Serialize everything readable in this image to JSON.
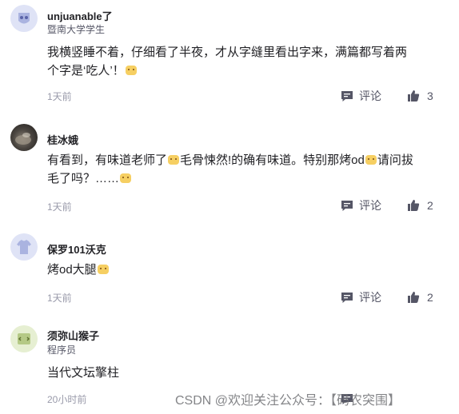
{
  "comments": [
    {
      "username": "unjuanable了",
      "subtitle": "暨南大学学生",
      "avatar": "student-avatar",
      "lines": [
        "我横竖睡不着，仔细看了半夜，才从字缝里看出字来，满篇都写着两",
        "个字是‘吃人’！"
      ],
      "time": "1天前",
      "reply_label": "评论",
      "likes": "3"
    },
    {
      "username": "桂冰娥",
      "subtitle": "",
      "avatar": "photo-avatar",
      "lines": [
        "有看到，有味道老师了",
        "毛骨悚然!的确有味道。特别那烤od",
        "请问拔",
        "毛了吗？……"
      ],
      "time": "1天前",
      "reply_label": "评论",
      "likes": "2"
    },
    {
      "username": "保罗101沃克",
      "subtitle": "",
      "avatar": "tshirt-avatar",
      "lines": [
        "烤od大腿"
      ],
      "time": "1天前",
      "reply_label": "评论",
      "likes": "2"
    },
    {
      "username": "须弥山猴子",
      "subtitle": "程序员",
      "avatar": "coder-avatar",
      "lines": [
        "当代文坛擎柱"
      ],
      "time": "20小时前",
      "reply_label": "评论",
      "likes": ""
    }
  ],
  "watermark": "CSDN @欢迎关注公众号：【码农突围】",
  "colors": {
    "text": "#222226",
    "meta": "#999aaa",
    "action": "#555666",
    "emoji": "#f6cf62"
  },
  "icons": [
    "comment-icon",
    "thumbs-up-icon",
    "smile-emoji-icon"
  ]
}
